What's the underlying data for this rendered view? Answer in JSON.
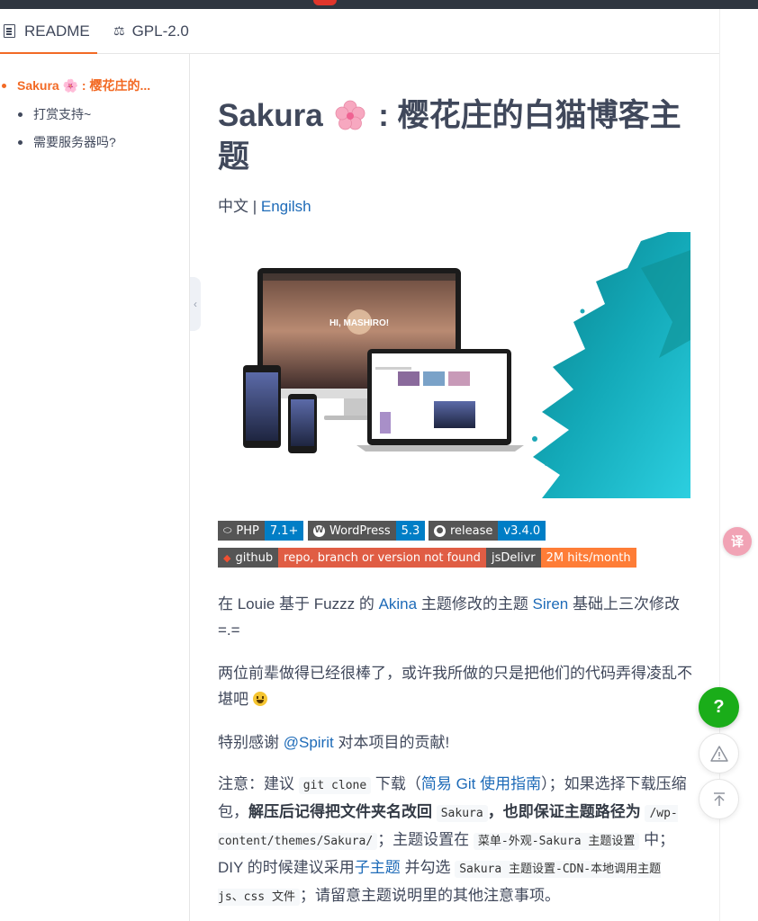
{
  "tabs": {
    "readme_label": "README",
    "license_label": "GPL-2.0",
    "license_icon": "⚖"
  },
  "toc": {
    "items": [
      {
        "label": "Sakura 🌸 : 樱花庄的...",
        "active": true
      },
      {
        "label": "打赏支持~"
      },
      {
        "label": "需要服务器吗?"
      }
    ]
  },
  "readme": {
    "title_part1": "Sakura",
    "title_part2": ": 樱花庄的白猫博客主题",
    "lang_zh": "中文",
    "lang_sep": " | ",
    "lang_en": "Engilsh",
    "hero_caption": "HI, MASHIRO!",
    "badges": {
      "php_label": "PHP",
      "php_value": "7.1+",
      "wp_label": "WordPress",
      "wp_value": "5.3",
      "release_label": "release",
      "release_value": "v3.4.0",
      "github_label": "github",
      "github_value": "repo, branch or version not found",
      "jsd_label": "jsDelivr",
      "jsd_value": "2M hits/month"
    },
    "p1": {
      "t1": "在 Louie 基于 Fuzzz 的 ",
      "link1": "Akina",
      "t2": " 主题修改的主题 ",
      "link2": "Siren",
      "t3": " 基础上三次修改 =.="
    },
    "p2": "两位前辈做得已经很棒了，或许我所做的只是把他们的代码弄得凌乱不堪吧 ",
    "p3": {
      "t1": "特别感谢 ",
      "link": "@Spirit",
      "t2": " 对本项目的贡献!"
    },
    "p4": {
      "t1": "注意：建议 ",
      "code1": "git clone",
      "t2": " 下载（",
      "link1": "简易 Git 使用指南",
      "t3": "）；如果选择下载压缩包，",
      "b1": "解压后记得把文件夹名改回 ",
      "code2": "Sakura",
      "b2": "，也即保证主题路径为 ",
      "code3": "/wp-content/themes/Sakura/",
      "t4": "；主题设置在 ",
      "code4": "菜单-外观-Sakura 主题设置",
      "t5": " 中；DIY 的时候建议采用",
      "link2": "子主题",
      "t6": " 并勾选 ",
      "code5": "Sakura 主题设置-CDN-本地调用主题 js、css 文件",
      "t7": "；请留意主题说明里的其他注意事项。"
    }
  },
  "floating": {
    "translate_label": "译",
    "help_label": "?"
  },
  "colors": {
    "accent": "#f26a25",
    "link": "#1e6bb8",
    "help_green": "#1aad19",
    "badge_grey": "#555555",
    "badge_blue": "#007ec6",
    "badge_red": "#e05d44",
    "badge_orange": "#fe7d37"
  }
}
